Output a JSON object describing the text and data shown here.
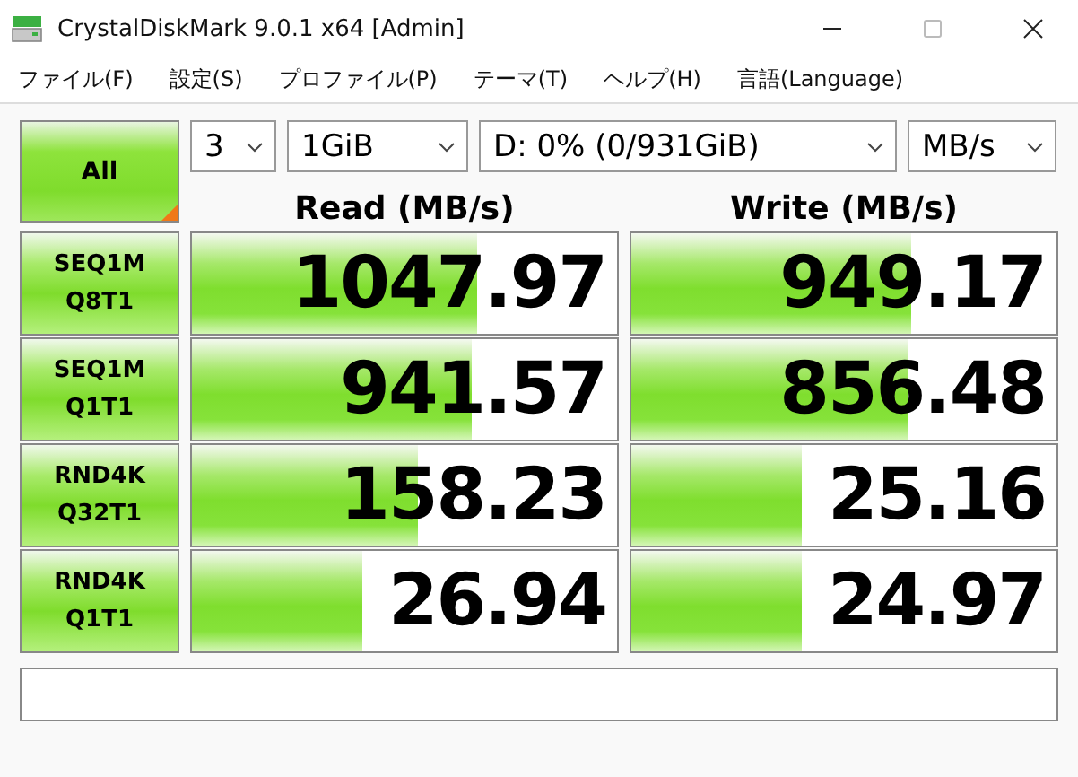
{
  "window": {
    "title": "CrystalDiskMark 9.0.1 x64 [Admin]"
  },
  "menu": [
    {
      "label": "ファイル(F)"
    },
    {
      "label": "設定(S)"
    },
    {
      "label": "プロファイル(P)"
    },
    {
      "label": "テーマ(T)"
    },
    {
      "label": "ヘルプ(H)"
    },
    {
      "label": "言語(Language)"
    }
  ],
  "all_button": {
    "label": "All"
  },
  "settings": [
    {
      "value": "3"
    },
    {
      "value": "1GiB"
    },
    {
      "value": "D: 0% (0/931GiB)"
    },
    {
      "value": "MB/s"
    }
  ],
  "columns": [
    "Read (MB/s)",
    "Write (MB/s)"
  ],
  "tests": [
    {
      "name": "SEQ1M",
      "params": "Q8T1",
      "read": {
        "value": "1047.97",
        "level": 0.67
      },
      "write": {
        "value": "949.17",
        "level": 0.66
      }
    },
    {
      "name": "SEQ1M",
      "params": "Q1T1",
      "read": {
        "value": "941.57",
        "level": 0.66
      },
      "write": {
        "value": "856.48",
        "level": 0.65
      }
    },
    {
      "name": "RND4K",
      "params": "Q32T1",
      "read": {
        "value": "158.23",
        "level": 0.53
      },
      "write": {
        "value": "25.16",
        "level": 0.4
      }
    },
    {
      "name": "RND4K",
      "params": "Q1T1",
      "read": {
        "value": "26.94",
        "level": 0.4
      },
      "write": {
        "value": "24.97",
        "level": 0.4
      }
    }
  ]
}
